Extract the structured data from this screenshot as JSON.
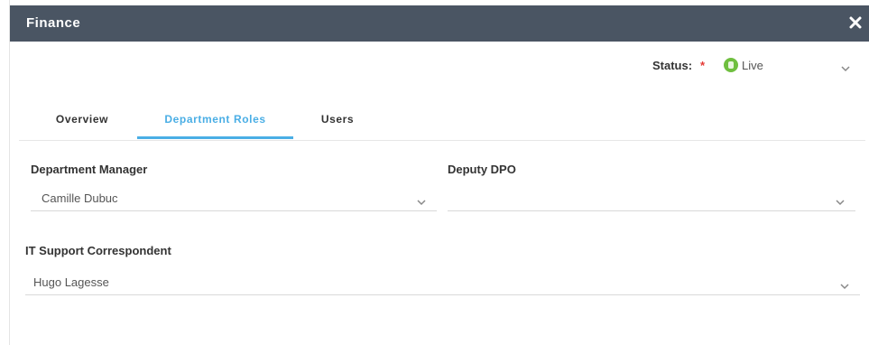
{
  "dialog": {
    "title": "Finance",
    "close_icon": "close-icon"
  },
  "status": {
    "label": "Status:",
    "required_mark": "*",
    "value": "Live",
    "indicator_color": "#6fbf3f"
  },
  "tabs": [
    {
      "label": "Overview",
      "active": false
    },
    {
      "label": "Department Roles",
      "active": true
    },
    {
      "label": "Users",
      "active": false
    }
  ],
  "fields": [
    {
      "label": "Department Manager",
      "value": "Camille Dubuc"
    },
    {
      "label": "Deputy DPO",
      "value": ""
    },
    {
      "label": "IT Support Correspondent",
      "value": "Hugo Lagesse"
    }
  ],
  "colors": {
    "header_bg": "#4a5563",
    "accent": "#4aaee5",
    "required": "#e53935"
  }
}
